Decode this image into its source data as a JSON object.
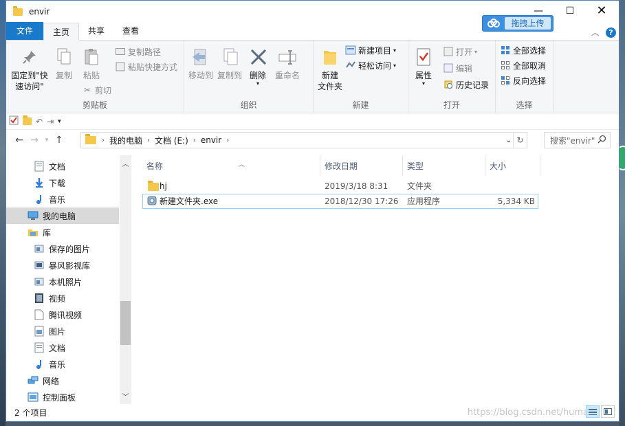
{
  "window": {
    "title": "envir",
    "minimize_glyph": "—",
    "maximize_glyph": "☐",
    "close_glyph": "✕"
  },
  "upload": {
    "label": "拖拽上传"
  },
  "tabs": [
    {
      "label": "文件"
    },
    {
      "label": "主页"
    },
    {
      "label": "共享"
    },
    {
      "label": "查看"
    }
  ],
  "ribbon": {
    "clipboard": {
      "group_label": "剪贴板",
      "pin_label_1": "固定到\"快",
      "pin_label_2": "速访问\"",
      "copy_label": "复制",
      "paste_label": "粘贴",
      "copy_path": "复制路径",
      "paste_shortcut": "粘贴快捷方式",
      "cut": "剪切"
    },
    "organize": {
      "group_label": "组织",
      "move_to": "移动到",
      "copy_to": "复制到",
      "delete": "删除",
      "rename": "重命名"
    },
    "new": {
      "group_label": "新建",
      "new_item": "新建项目",
      "easy_access": "轻松访问",
      "new_folder_1": "新建",
      "new_folder_2": "文件夹"
    },
    "open": {
      "group_label": "打开",
      "properties": "属性",
      "open": "打开",
      "edit": "编辑",
      "history": "历史记录"
    },
    "select": {
      "group_label": "选择",
      "select_all": "全部选择",
      "select_none": "全部取消",
      "invert": "反向选择"
    }
  },
  "address": {
    "crumbs": [
      "我的电脑",
      "文档 (E:)",
      "envir"
    ],
    "search_placeholder": "搜索\"envir\""
  },
  "nav": [
    {
      "label": "文档",
      "icon": "document-icon"
    },
    {
      "label": "下载",
      "icon": "download-icon"
    },
    {
      "label": "音乐",
      "icon": "music-icon"
    },
    {
      "label": "我的电脑",
      "icon": "computer-icon",
      "selected": true
    },
    {
      "label": "库",
      "icon": "library-icon"
    },
    {
      "label": "保存的图片",
      "icon": "pictures-library-icon"
    },
    {
      "label": "暴风影视库",
      "icon": "video-library-icon"
    },
    {
      "label": "本机照片",
      "icon": "photos-library-icon"
    },
    {
      "label": "视频",
      "icon": "video-icon"
    },
    {
      "label": "腾讯视频",
      "icon": "file-icon"
    },
    {
      "label": "图片",
      "icon": "picture-icon"
    },
    {
      "label": "文档",
      "icon": "document-icon"
    },
    {
      "label": "音乐",
      "icon": "music-icon"
    },
    {
      "label": "网络",
      "icon": "network-icon"
    },
    {
      "label": "控制面板",
      "icon": "control-panel-icon"
    }
  ],
  "columns": {
    "name": "名称",
    "modified": "修改日期",
    "type": "类型",
    "size": "大小"
  },
  "files": [
    {
      "name": "hj",
      "modified": "2019/3/18 8:31",
      "type": "文件夹",
      "size": ""
    },
    {
      "name": "新建文件夹.exe",
      "modified": "2018/12/30 17:26",
      "type": "应用程序",
      "size": "5,334 KB"
    }
  ],
  "status": {
    "count": "2 个项目",
    "watermark": "https://blog.csdn.net/huma"
  },
  "colors": {
    "accent": "#1979ca",
    "folder": "#f4c84c",
    "selection": "#cce8ff"
  }
}
